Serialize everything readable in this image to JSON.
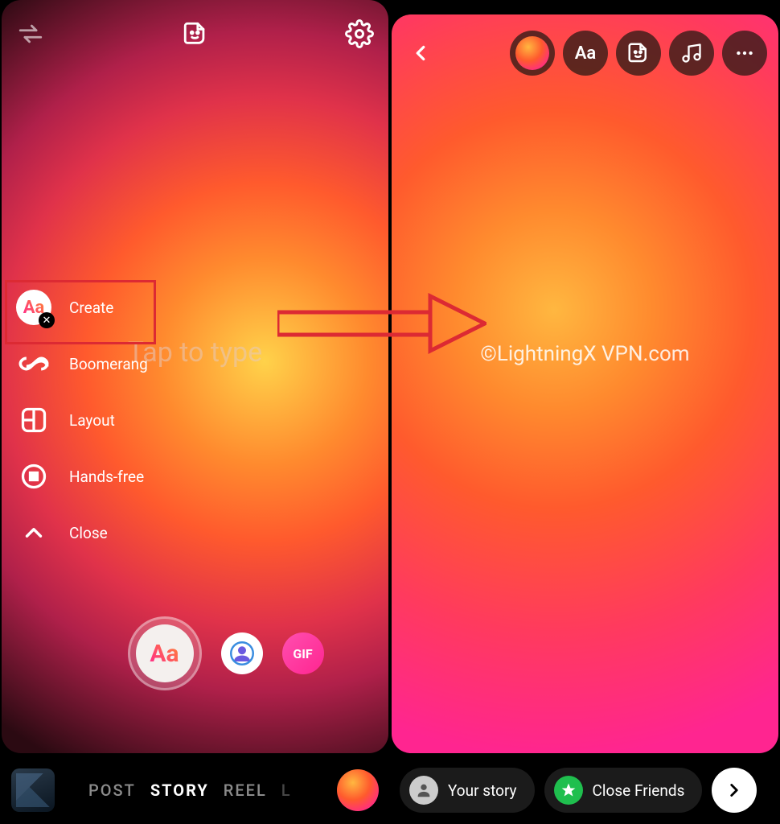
{
  "left": {
    "placeholder": "Tap to type",
    "menu": {
      "create": "Create",
      "boomerang": "Boomerang",
      "layout": "Layout",
      "handsfree": "Hands-free",
      "close": "Close"
    },
    "effects": {
      "aa": "Aa",
      "gif": "GIF"
    },
    "tabs": {
      "post": "POST",
      "story": "STORY",
      "reel": "REEL",
      "live_initial": "L"
    }
  },
  "right": {
    "toolbar_aa": "Aa",
    "watermark": "©LightningX VPN.com",
    "your_story": "Your story",
    "close_friends": "Close Friends"
  }
}
